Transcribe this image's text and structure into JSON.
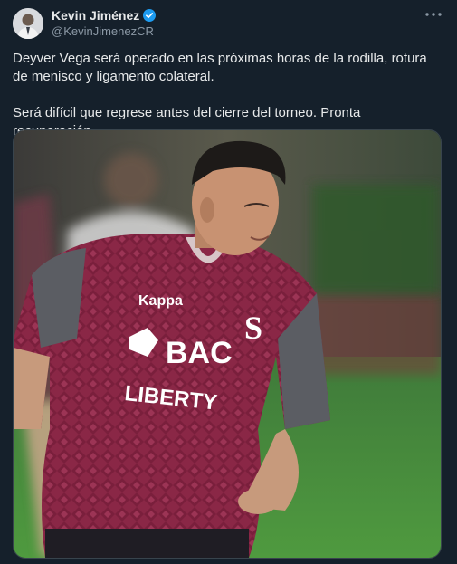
{
  "author": {
    "display_name": "Kevin Jiménez",
    "handle": "@KevinJimenezCR",
    "verified": true,
    "verified_icon": "verified-badge-icon",
    "avatar": "avatar-photo"
  },
  "menu": {
    "icon": "more-options-icon"
  },
  "tweet": {
    "paragraphs": [
      "Deyver Vega será operado en las próximas horas de la rodilla, rotura de menisco y ligamento colateral.",
      "Será difícil que regrese antes del cierre del torneo. Pronta recuperación."
    ]
  },
  "media": {
    "kind": "photo",
    "jersey_sponsor_line1": "BAC",
    "jersey_sponsor_line2": "LIBERTY",
    "jersey_crest": "S",
    "kit_brand": "Kappa"
  },
  "colors": {
    "background": "#15202b",
    "text": "#e7e9ea",
    "secondary_text": "#8b98a5",
    "verified": "#1d9bf0",
    "jersey": "#8a2746"
  }
}
